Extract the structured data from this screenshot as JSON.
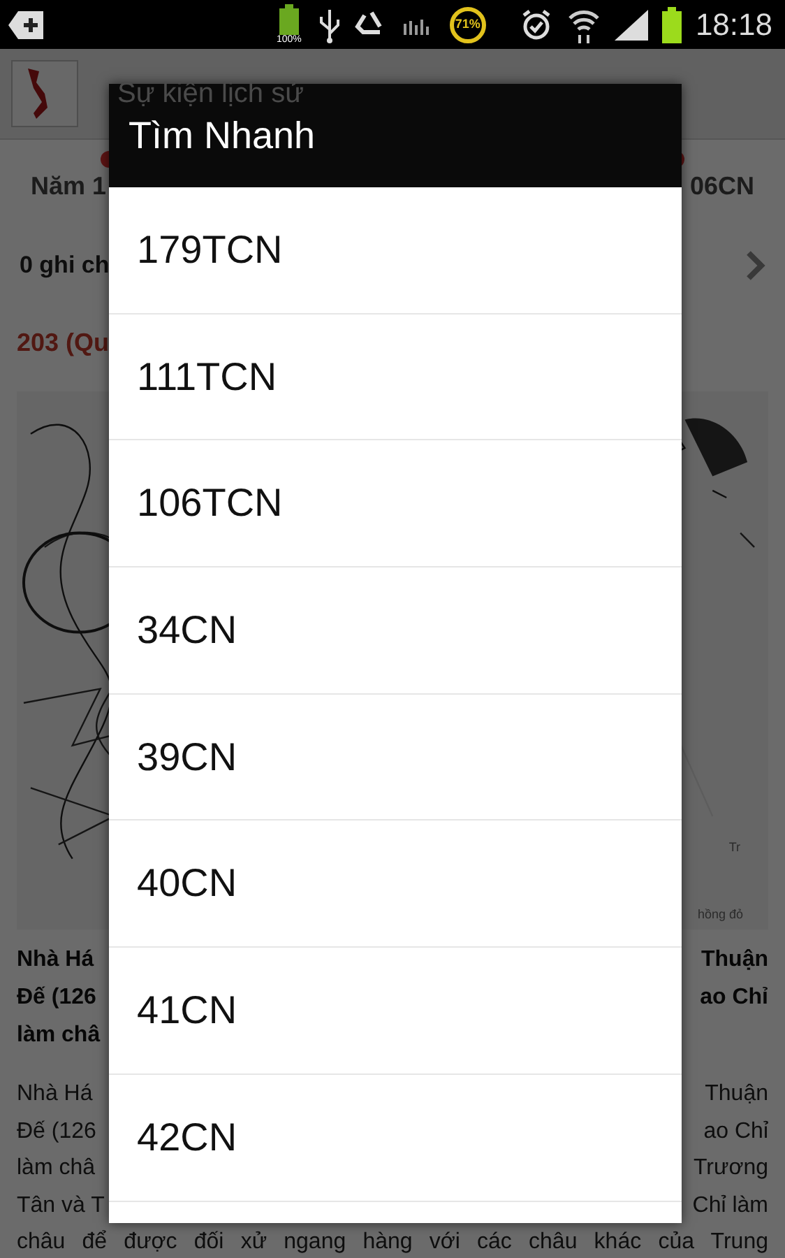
{
  "status_bar": {
    "battery_badge": "100%",
    "progress_badge": "71%",
    "time": "18:18"
  },
  "app_bar": {
    "title": "Sự kiện lịch sử"
  },
  "timeline": {
    "left": "Năm 1",
    "right": "06CN"
  },
  "notes": {
    "text": "0 ghi ch"
  },
  "event": {
    "heading": "203 (Qu",
    "map_labels": [
      "Tr",
      "hồng đỏ"
    ]
  },
  "summary": [
    {
      "left": "Nhà Há",
      "right": "Thuận"
    },
    {
      "left": "Đế (126",
      "right": "ao Chỉ"
    },
    {
      "left": "làm châ"
    }
  ],
  "body": [
    {
      "left": "Nhà Há",
      "right": "Thuận"
    },
    {
      "left": "Đế (126",
      "right": "ao Chỉ"
    },
    {
      "left": "làm châ",
      "right": "Trương"
    },
    {
      "left": "Tân và T",
      "right": "Chỉ làm"
    },
    {
      "full": "châu để được đối xử ngang hàng với các châu khác của Trung"
    }
  ],
  "dialog": {
    "title": "Tìm Nhanh",
    "items": [
      "179TCN",
      "111TCN",
      "106TCN",
      "34CN",
      "39CN",
      "40CN",
      "41CN",
      "42CN"
    ]
  }
}
